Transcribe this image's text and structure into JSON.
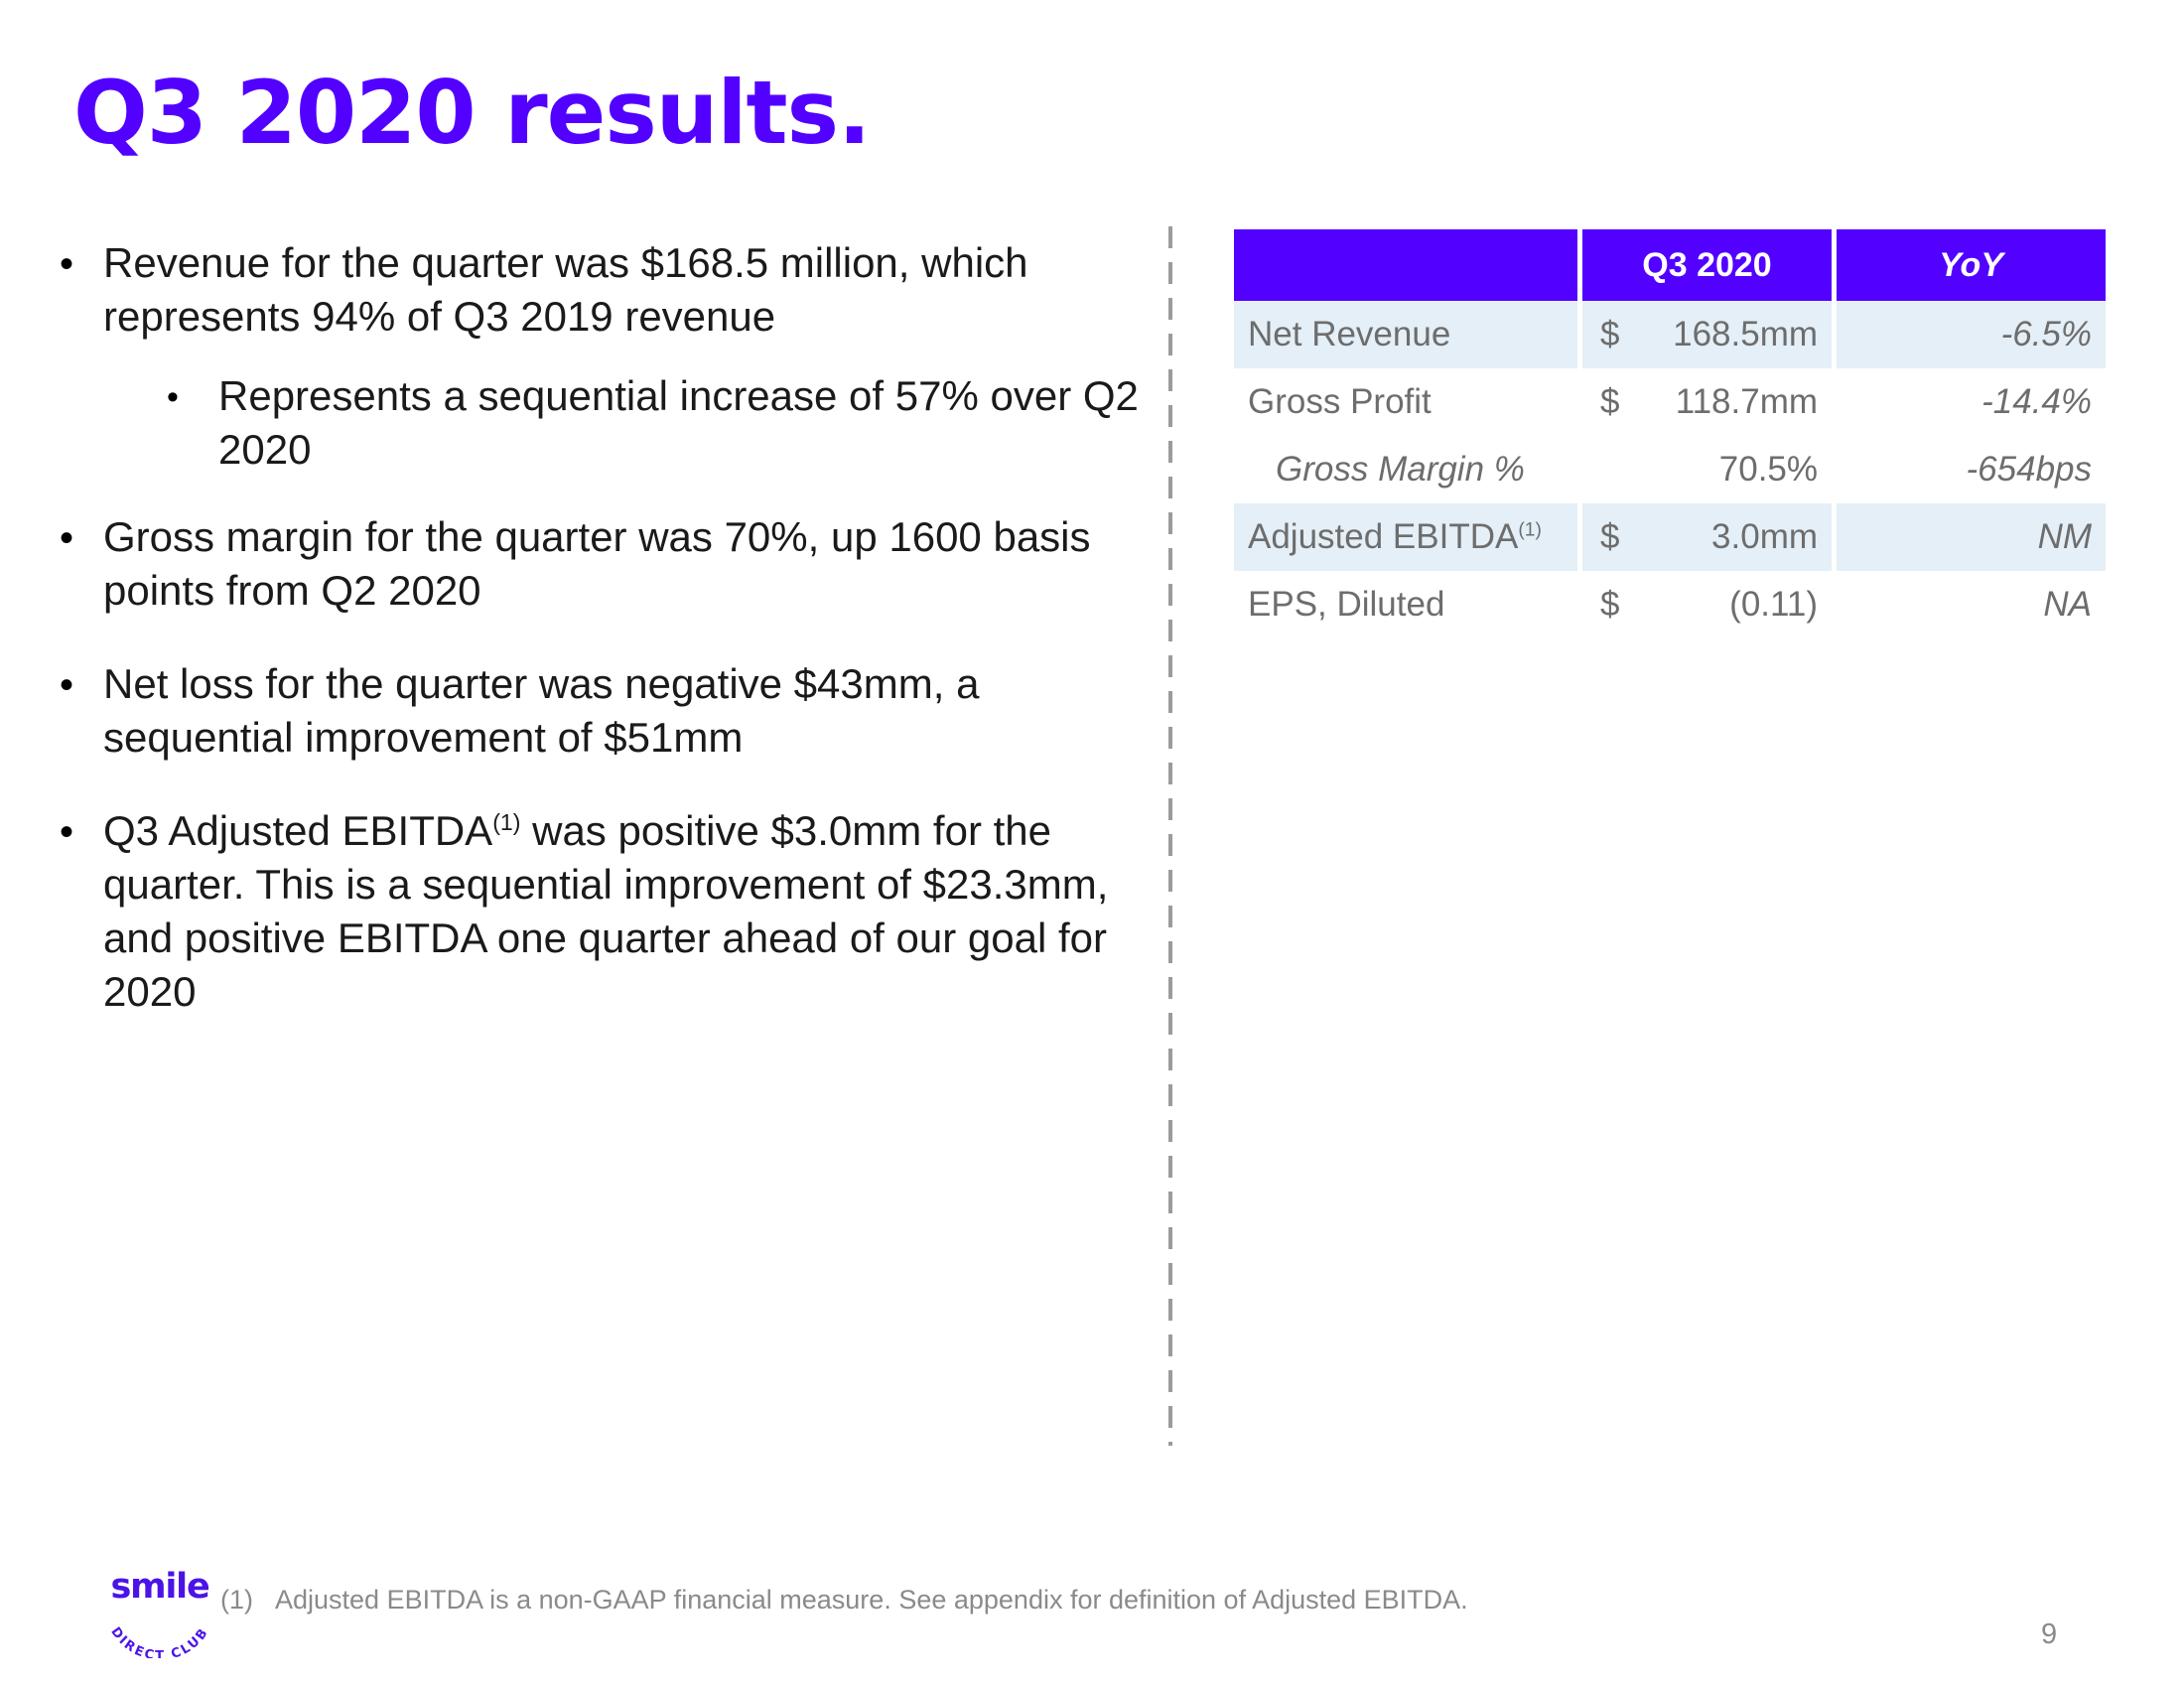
{
  "slide": {
    "title": "Q3 2020 results.",
    "page_number": "9",
    "accent_purple": "#5200FF",
    "row_band_color": "#E4EFF7",
    "body_text_color": "#1A1A1A"
  },
  "bullets": [
    {
      "level": 1,
      "marker": "•",
      "text_before": "Revenue for the quarter was $168.5 million, which represents 94% of Q3 2019 revenue",
      "sup": "",
      "text_after": ""
    },
    {
      "level": 2,
      "marker": "•",
      "text_before": "Represents a sequential increase of 57% over Q2 2020",
      "sup": "",
      "text_after": ""
    },
    {
      "level": 1,
      "marker": "•",
      "text_before": "Gross margin for the quarter was 70%, up 1600 basis points from Q2 2020",
      "sup": "",
      "text_after": ""
    },
    {
      "level": 1,
      "marker": "•",
      "text_before": "Net loss for the quarter was negative $43mm, a sequential improvement of $51mm",
      "sup": "",
      "text_after": ""
    },
    {
      "level": 1,
      "marker": "•",
      "text_before": "Q3 Adjusted EBITDA",
      "sup": "(1)",
      "text_after": " was positive $3.0mm for the quarter. This is a sequential improvement of $23.3mm, and positive EBITDA one quarter ahead of our goal for 2020"
    }
  ],
  "table": {
    "headers": {
      "blank": "",
      "period": "Q3 2020",
      "yoy": "YoY"
    },
    "rows": [
      {
        "label": "Net Revenue",
        "label_sup": "",
        "dollar": "$",
        "value": "168.5mm",
        "yoy": "-6.5%",
        "band": true,
        "indent": false
      },
      {
        "label": "Gross Profit",
        "label_sup": "",
        "dollar": "$",
        "value": "118.7mm",
        "yoy": "-14.4%",
        "band": false,
        "indent": false
      },
      {
        "label": "Gross Margin %",
        "label_sup": "",
        "dollar": "",
        "value": "70.5%",
        "yoy": "-654bps",
        "band": false,
        "indent": true
      },
      {
        "label": "Adjusted EBITDA",
        "label_sup": "(1)",
        "dollar": "$",
        "value": "3.0mm",
        "yoy": "NM",
        "band": true,
        "indent": false
      },
      {
        "label": "EPS, Diluted",
        "label_sup": "",
        "dollar": "$",
        "value": "(0.11)",
        "yoy": "NA",
        "band": false,
        "indent": false
      }
    ]
  },
  "footer": {
    "logo_word": "smile",
    "logo_arc": "DIRECT CLUB",
    "footnote_number": "(1)",
    "footnote_text": "Adjusted EBITDA is a non-GAAP financial measure. See appendix for definition of Adjusted EBITDA."
  }
}
